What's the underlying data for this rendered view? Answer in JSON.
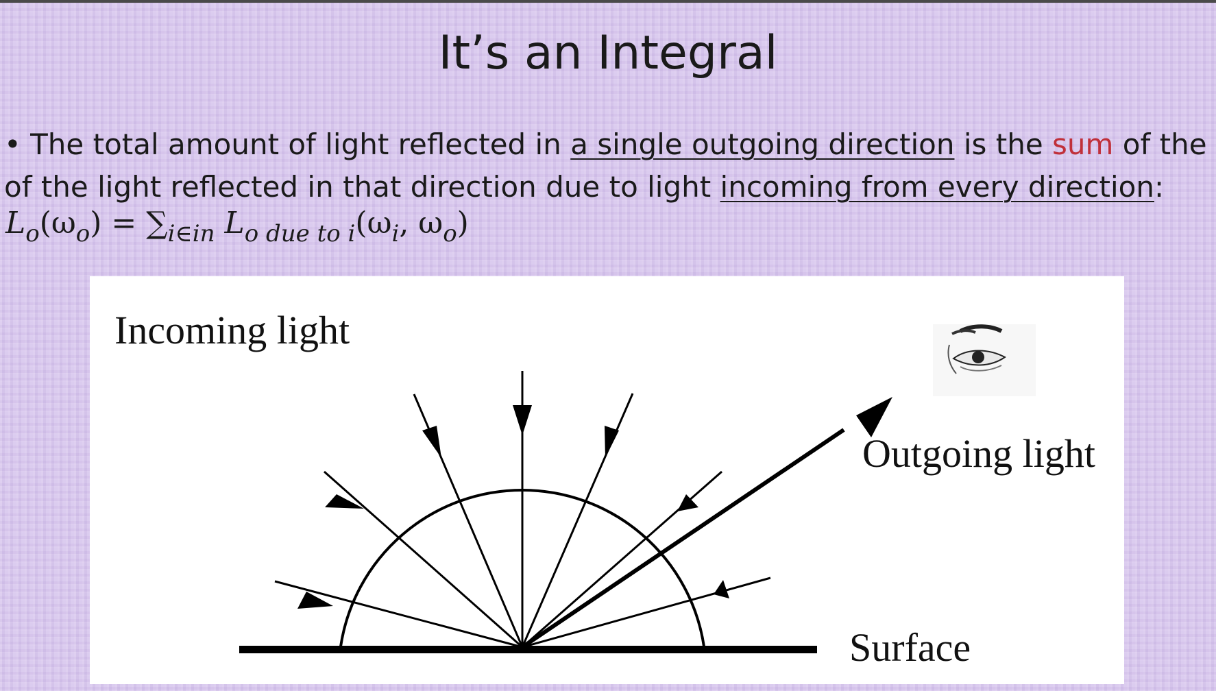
{
  "slide": {
    "title": "It’s an Integral",
    "bullet": {
      "marker": "•",
      "part1": "The total amount of light reflected in ",
      "link1": "a single outgoing direction",
      "part2": " is the ",
      "highlight": "sum",
      "part3": " of the of the light reflected in that direction due to light ",
      "link2": "incoming from every direction",
      "part4": ":"
    },
    "formula": {
      "lhs": "L",
      "lhs_sub": "o",
      "lhs_arg": "(ω",
      "lhs_arg_sub": "o",
      "lhs_close": ")",
      "equals": " = ",
      "sum_symbol": "∑",
      "sum_sub": "i∈in",
      "rhs": " L",
      "rhs_sub": "o due to i",
      "rhs_arg1": "(ω",
      "rhs_arg1_sub": "i",
      "rhs_comma": ", ω",
      "rhs_arg2_sub": "o",
      "rhs_close": ")"
    }
  },
  "diagram": {
    "incoming_label": "Incoming light",
    "outgoing_label": "Outgoing light",
    "surface_label": "Surface",
    "eye_icon": "eye-icon",
    "colors": {
      "ink": "#000000",
      "background": "#ffffff"
    }
  }
}
